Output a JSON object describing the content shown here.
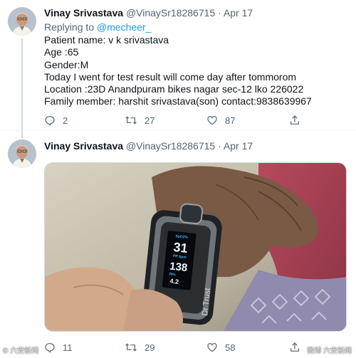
{
  "tweets": [
    {
      "author_name": "Vinay Srivastava",
      "author_handle": "@VinaySr18286715",
      "separator": "·",
      "date": "Apr 17",
      "replying_prefix": "Replying to",
      "replying_handle": "@mecheer_",
      "lines": [
        "Patient name: v k srivastava",
        "Age :65",
        "Gender:M",
        "Today I went for test result will come day after tommorom",
        "Location :23D Anandpuram bikes nagar sec-12 lko 226022",
        "Family member: harshit srivastava(son) contact:9838639967"
      ],
      "replies": "2",
      "retweets": "27",
      "likes": "87"
    },
    {
      "author_name": "Vinay Srivastava",
      "author_handle": "@VinaySr18286715",
      "separator": "·",
      "date": "Apr 17",
      "media": {
        "device_brand": "Dr Trust",
        "spo2_label": "SpO2%",
        "spo2_value": "31",
        "pulse_label": "PR bpm",
        "pulse_value": "138",
        "pi_label": "PI%",
        "pi_value": "4.2"
      },
      "replies": "11",
      "retweets": "29",
      "likes": "58"
    }
  ],
  "watermarks": {
    "left": "© 六安新闻",
    "right": "微博 六安新闻"
  },
  "icons": [
    "avatar",
    "reply-icon",
    "retweet-icon",
    "like-icon",
    "share-icon"
  ]
}
